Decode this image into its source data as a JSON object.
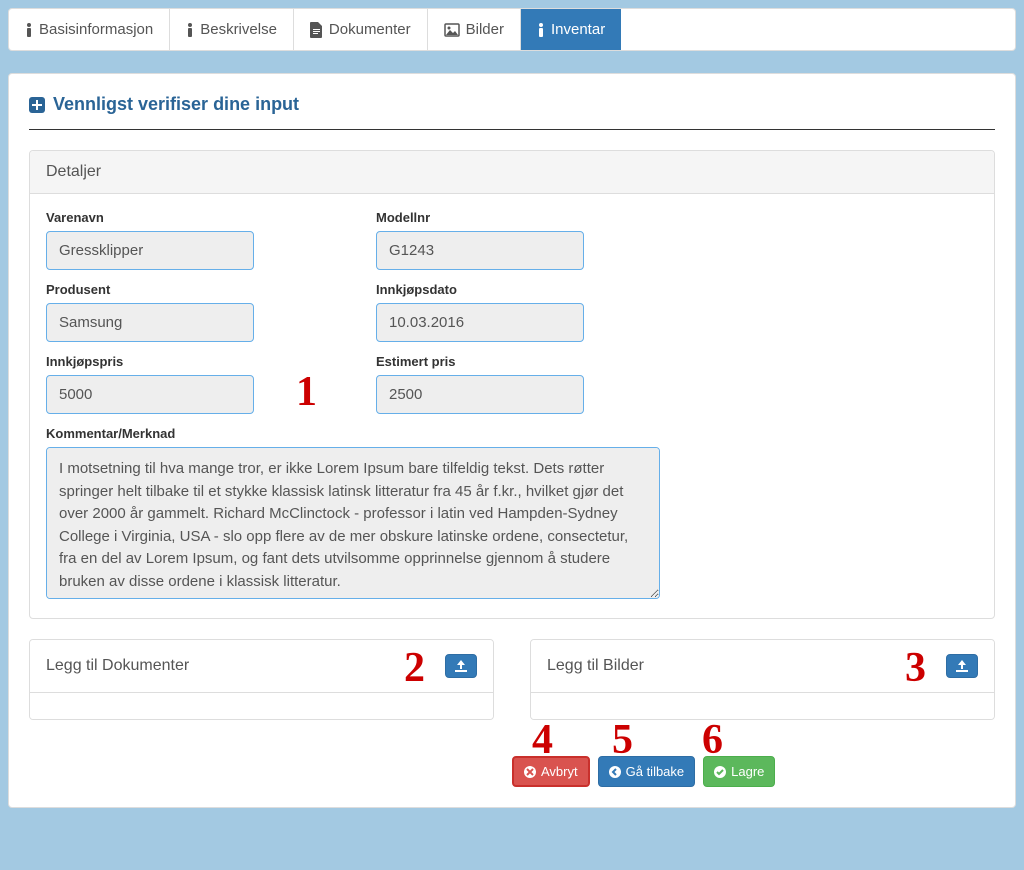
{
  "tabs": {
    "basis": "Basisinformasjon",
    "beskriv": "Beskrivelse",
    "dok": "Dokumenter",
    "bilder": "Bilder",
    "inventar": "Inventar"
  },
  "verify_title": "Vennligst verifiser dine input",
  "panel_title": "Detaljer",
  "fields": {
    "varenavn": {
      "label": "Varenavn",
      "value": "Gressklipper"
    },
    "modellnr": {
      "label": "Modellnr",
      "value": "G1243"
    },
    "produsent": {
      "label": "Produsent",
      "value": "Samsung"
    },
    "innkjopsdato": {
      "label": "Innkjøpsdato",
      "value": "10.03.2016"
    },
    "innkjopspris": {
      "label": "Innkjøpspris",
      "value": "5000"
    },
    "estimert": {
      "label": "Estimert pris",
      "value": "2500"
    },
    "kommentar": {
      "label": "Kommentar/Merknad",
      "value": "I motsetning til hva mange tror, er ikke Lorem Ipsum bare tilfeldig tekst. Dets røtter springer helt tilbake til et stykke klassisk latinsk litteratur fra 45 år f.kr., hvilket gjør det over 2000 år gammelt. Richard McClinctock - professor i latin ved Hampden-Sydney College i Virginia, USA - slo opp flere av de mer obskure latinske ordene, consectetur, fra en del av Lorem Ipsum, og fant dets utvilsomme opprinnelse gjennom å studere bruken av disse ordene i klassisk litteratur."
    }
  },
  "uploads": {
    "dok": "Legg til Dokumenter",
    "bilder": "Legg til Bilder"
  },
  "buttons": {
    "avbryt": "Avbryt",
    "ga_tilbake": "Gå tilbake",
    "lagre": "Lagre"
  },
  "annot": {
    "1": "1",
    "2": "2",
    "3": "3",
    "4": "4",
    "5": "5",
    "6": "6"
  }
}
